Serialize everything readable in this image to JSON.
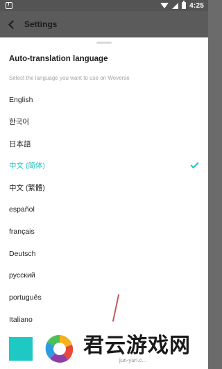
{
  "status_bar": {
    "time": "4:25",
    "icons": [
      "settings-icon",
      "warning-icon",
      "wifi-icon",
      "signal-icon",
      "battery-icon"
    ]
  },
  "header": {
    "title": "Settings",
    "back_icon": "chevron-left-icon"
  },
  "sheet": {
    "title": "Auto-translation language",
    "subtitle": "Select the language you want to use on Weverse",
    "languages": [
      {
        "label": "English",
        "selected": false
      },
      {
        "label": "한국어",
        "selected": false
      },
      {
        "label": "日本語",
        "selected": false
      },
      {
        "label": "中文 (简体)",
        "selected": true
      },
      {
        "label": "中文 (繁體)",
        "selected": false
      },
      {
        "label": "español",
        "selected": false
      },
      {
        "label": "français",
        "selected": false
      },
      {
        "label": "Deutsch",
        "selected": false
      },
      {
        "label": "русский",
        "selected": false
      },
      {
        "label": "português",
        "selected": false
      },
      {
        "label": "Italiano",
        "selected": false
      }
    ]
  },
  "watermark": {
    "text": "君云游戏网",
    "sub": "jun-yun.c..."
  },
  "colors": {
    "accent": "#18c6c0",
    "swatch": "#1fc9c3"
  }
}
